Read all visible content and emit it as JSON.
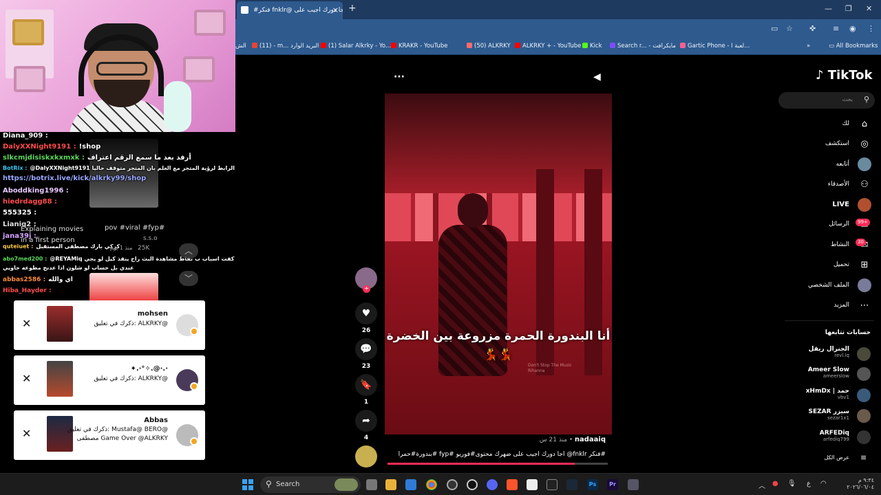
{
  "browser": {
    "tab_title": "#فنكر fnklr@ اجا دورك اجيب على",
    "new_tab_symbol": "+",
    "tab_close": "×",
    "window_controls": [
      "—",
      "❐",
      "✕"
    ]
  },
  "bookmarks": {
    "items": [
      {
        "label": "الش",
        "color": "#6c8ebf"
      },
      {
        "label": "(11) - m...",
        "color": "#ea4335"
      },
      {
        "label": "البريد الوارد",
        "color": "#ea4335"
      },
      {
        "label": "(1) Salar Alkrky - Yo...",
        "color": "#ff0000"
      },
      {
        "label": "KRAKR - YouTube",
        "color": "#ff0000"
      },
      {
        "label": "(50) ALKRKY",
        "color": "#ff6b6b"
      },
      {
        "label": "ALKRKY + - YouTube",
        "color": "#ff0000"
      },
      {
        "label": "Kick",
        "color": "#53fc18"
      },
      {
        "label": "Search r... - مايكرافت",
        "color": "#7c4dff"
      },
      {
        "label": "Gartic Phone - لعبة ا...",
        "color": "#f06292"
      }
    ],
    "more": "»",
    "all_bookmarks": "All Bookmarks"
  },
  "stream_chat": {
    "lines": [
      {
        "user": "Diana_909 :",
        "text": "",
        "color": "#f5f5f5"
      },
      {
        "user": "DalyXXNight9191 :",
        "text": "!shop",
        "color": "#ff4b4b"
      },
      {
        "user": "slkcmjdisiskxkxmxk :",
        "text": "أرفد بعد ما سمع الرقم اعتراف",
        "color": "#5cd65c"
      },
      {
        "user": "BotRix :",
        "text": "@DalyXXNight9191 اضغط على الرابط لرؤية المتجر مع العلم بان المتجر متوقف حاليا",
        "color": "#39c6f4"
      },
      {
        "user": "",
        "text": "https://botrix.live/kick/alkrky99/shop",
        "color": "#9aa7ff"
      },
      {
        "user": "Aboddking1996 :",
        "text": "",
        "color": "#e7c7ff"
      },
      {
        "user": "hiedrdagg88 :",
        "text": "",
        "color": "#ff4b4b"
      },
      {
        "user": "555325 :",
        "text": "",
        "color": "#ffffff"
      },
      {
        "user": "Lianiq2 :",
        "text": "",
        "color": "#e0e0e0"
      },
      {
        "user": "jana39j :",
        "text": "",
        "color": "#d6a4ff"
      },
      {
        "user": "quteiuet :",
        "text": "كركي بارك مصطفى المستقبل",
        "color": "#ffcb48"
      },
      {
        "user": "abo7med200 :",
        "text": "@REYAMiq قد سؤال اذا اشتريت كفت اسباب ب نقاط مشاهدة البث راح ينفذ كيل لو يجي",
        "color": "#5cd65c"
      },
      {
        "user": "",
        "text": "عندي بل حساب لو شلون اذا عدنج مطوعه جاويي",
        "color": "#ffffff"
      },
      {
        "user": "abbas2586 :",
        "text": "اي والله",
        "color": "#ff8c3a"
      },
      {
        "user": "Hiba_Hayder :",
        "text": "",
        "color": "#ff4b4b"
      }
    ],
    "thumb_a": {
      "title": "Explaining movies in a first person",
      "caption": "pov #viral #fyp#",
      "user": "s.s.o",
      "time": "منذ 1 يوم",
      "likes": "25K"
    },
    "up_chevron": "︿",
    "down_chevron": "﹀"
  },
  "notifications": [
    {
      "name": "mohsen",
      "message": "ذكرك في تعليق: ALKRKY@",
      "thumb_color": "#b33",
      "avatar_color": "#ddd"
    },
    {
      "name": "✦.·°✧.@·.·",
      "message": "ذكرك في تعليق: ALKRKY@",
      "thumb_color": "#335",
      "avatar_color": "#4a3a5a"
    },
    {
      "name": "Abbas",
      "message": "ذكرك في تعليق: Mustafa@ BERO@ مصطفى Game Over @ALKRKY",
      "thumb_color": "#533",
      "avatar_color": "#bbb"
    }
  ],
  "tiktok": {
    "logo": "TikTok",
    "search_placeholder": "بحث",
    "nav": [
      {
        "label": "لك",
        "icon": "⌂"
      },
      {
        "label": "استكشف",
        "icon": "◎"
      },
      {
        "label": "أتابعه",
        "icon": ""
      },
      {
        "label": "الأصدقاء",
        "icon": "⚇"
      },
      {
        "label": "LIVE",
        "icon": ""
      },
      {
        "label": "الرسائل",
        "icon": "✉",
        "badge": "99+"
      },
      {
        "label": "النشاط",
        "icon": "✉",
        "badge": "30"
      },
      {
        "label": "تحميل",
        "icon": "⊞"
      },
      {
        "label": "الملف الشخصي",
        "icon": ""
      },
      {
        "label": "المزيد",
        "icon": "⋯"
      }
    ],
    "following_title": "حسابات تتابعها",
    "following": [
      {
        "name": "الجنرال ريقل",
        "handle": "revl.iq"
      },
      {
        "name": "Ameer Slow",
        "handle": "ameerslow"
      },
      {
        "name": "xHmDx | حمد",
        "handle": "vbv1"
      },
      {
        "name": "SEZAR سيزر",
        "handle": "sezar1x1"
      },
      {
        "name": "ARFEDiq",
        "handle": "arfediq799"
      }
    ],
    "see_all": "عرض الكل",
    "video": {
      "caption": "أنا البندورة الحمرة مزروعة بين الخضرة 💃💃",
      "watermark": "Don't Stop The Music\nRihanna",
      "author": "nadaaiq",
      "time": "منذ 21 س",
      "description": "#فنكر fnklr@ اجا دورك اجيب على ضهرك محتوى#فوريو #fyp #بندورة#حمرا",
      "progress": 0.85,
      "more_icon": "···",
      "likes": "26",
      "comments": "23",
      "saves": "1",
      "shares": "4"
    }
  },
  "taskbar": {
    "search_label": "Search",
    "clock_time": "٩:٣٤ م",
    "clock_date": "٢٠٢٦/٠٦/٠٤",
    "lang": "ع"
  }
}
